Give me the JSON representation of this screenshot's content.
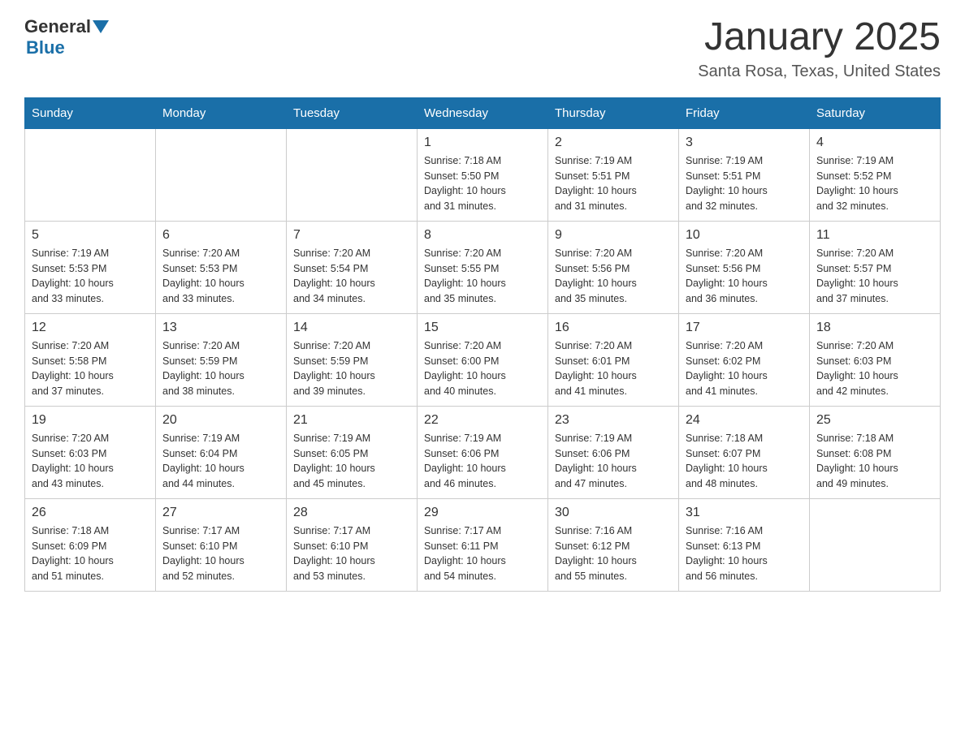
{
  "header": {
    "logo": {
      "general": "General",
      "triangle": "▲",
      "blue": "Blue"
    },
    "title": "January 2025",
    "subtitle": "Santa Rosa, Texas, United States"
  },
  "days_of_week": [
    "Sunday",
    "Monday",
    "Tuesday",
    "Wednesday",
    "Thursday",
    "Friday",
    "Saturday"
  ],
  "weeks": [
    [
      {
        "day": "",
        "info": ""
      },
      {
        "day": "",
        "info": ""
      },
      {
        "day": "",
        "info": ""
      },
      {
        "day": "1",
        "info": "Sunrise: 7:18 AM\nSunset: 5:50 PM\nDaylight: 10 hours\nand 31 minutes."
      },
      {
        "day": "2",
        "info": "Sunrise: 7:19 AM\nSunset: 5:51 PM\nDaylight: 10 hours\nand 31 minutes."
      },
      {
        "day": "3",
        "info": "Sunrise: 7:19 AM\nSunset: 5:51 PM\nDaylight: 10 hours\nand 32 minutes."
      },
      {
        "day": "4",
        "info": "Sunrise: 7:19 AM\nSunset: 5:52 PM\nDaylight: 10 hours\nand 32 minutes."
      }
    ],
    [
      {
        "day": "5",
        "info": "Sunrise: 7:19 AM\nSunset: 5:53 PM\nDaylight: 10 hours\nand 33 minutes."
      },
      {
        "day": "6",
        "info": "Sunrise: 7:20 AM\nSunset: 5:53 PM\nDaylight: 10 hours\nand 33 minutes."
      },
      {
        "day": "7",
        "info": "Sunrise: 7:20 AM\nSunset: 5:54 PM\nDaylight: 10 hours\nand 34 minutes."
      },
      {
        "day": "8",
        "info": "Sunrise: 7:20 AM\nSunset: 5:55 PM\nDaylight: 10 hours\nand 35 minutes."
      },
      {
        "day": "9",
        "info": "Sunrise: 7:20 AM\nSunset: 5:56 PM\nDaylight: 10 hours\nand 35 minutes."
      },
      {
        "day": "10",
        "info": "Sunrise: 7:20 AM\nSunset: 5:56 PM\nDaylight: 10 hours\nand 36 minutes."
      },
      {
        "day": "11",
        "info": "Sunrise: 7:20 AM\nSunset: 5:57 PM\nDaylight: 10 hours\nand 37 minutes."
      }
    ],
    [
      {
        "day": "12",
        "info": "Sunrise: 7:20 AM\nSunset: 5:58 PM\nDaylight: 10 hours\nand 37 minutes."
      },
      {
        "day": "13",
        "info": "Sunrise: 7:20 AM\nSunset: 5:59 PM\nDaylight: 10 hours\nand 38 minutes."
      },
      {
        "day": "14",
        "info": "Sunrise: 7:20 AM\nSunset: 5:59 PM\nDaylight: 10 hours\nand 39 minutes."
      },
      {
        "day": "15",
        "info": "Sunrise: 7:20 AM\nSunset: 6:00 PM\nDaylight: 10 hours\nand 40 minutes."
      },
      {
        "day": "16",
        "info": "Sunrise: 7:20 AM\nSunset: 6:01 PM\nDaylight: 10 hours\nand 41 minutes."
      },
      {
        "day": "17",
        "info": "Sunrise: 7:20 AM\nSunset: 6:02 PM\nDaylight: 10 hours\nand 41 minutes."
      },
      {
        "day": "18",
        "info": "Sunrise: 7:20 AM\nSunset: 6:03 PM\nDaylight: 10 hours\nand 42 minutes."
      }
    ],
    [
      {
        "day": "19",
        "info": "Sunrise: 7:20 AM\nSunset: 6:03 PM\nDaylight: 10 hours\nand 43 minutes."
      },
      {
        "day": "20",
        "info": "Sunrise: 7:19 AM\nSunset: 6:04 PM\nDaylight: 10 hours\nand 44 minutes."
      },
      {
        "day": "21",
        "info": "Sunrise: 7:19 AM\nSunset: 6:05 PM\nDaylight: 10 hours\nand 45 minutes."
      },
      {
        "day": "22",
        "info": "Sunrise: 7:19 AM\nSunset: 6:06 PM\nDaylight: 10 hours\nand 46 minutes."
      },
      {
        "day": "23",
        "info": "Sunrise: 7:19 AM\nSunset: 6:06 PM\nDaylight: 10 hours\nand 47 minutes."
      },
      {
        "day": "24",
        "info": "Sunrise: 7:18 AM\nSunset: 6:07 PM\nDaylight: 10 hours\nand 48 minutes."
      },
      {
        "day": "25",
        "info": "Sunrise: 7:18 AM\nSunset: 6:08 PM\nDaylight: 10 hours\nand 49 minutes."
      }
    ],
    [
      {
        "day": "26",
        "info": "Sunrise: 7:18 AM\nSunset: 6:09 PM\nDaylight: 10 hours\nand 51 minutes."
      },
      {
        "day": "27",
        "info": "Sunrise: 7:17 AM\nSunset: 6:10 PM\nDaylight: 10 hours\nand 52 minutes."
      },
      {
        "day": "28",
        "info": "Sunrise: 7:17 AM\nSunset: 6:10 PM\nDaylight: 10 hours\nand 53 minutes."
      },
      {
        "day": "29",
        "info": "Sunrise: 7:17 AM\nSunset: 6:11 PM\nDaylight: 10 hours\nand 54 minutes."
      },
      {
        "day": "30",
        "info": "Sunrise: 7:16 AM\nSunset: 6:12 PM\nDaylight: 10 hours\nand 55 minutes."
      },
      {
        "day": "31",
        "info": "Sunrise: 7:16 AM\nSunset: 6:13 PM\nDaylight: 10 hours\nand 56 minutes."
      },
      {
        "day": "",
        "info": ""
      }
    ]
  ]
}
